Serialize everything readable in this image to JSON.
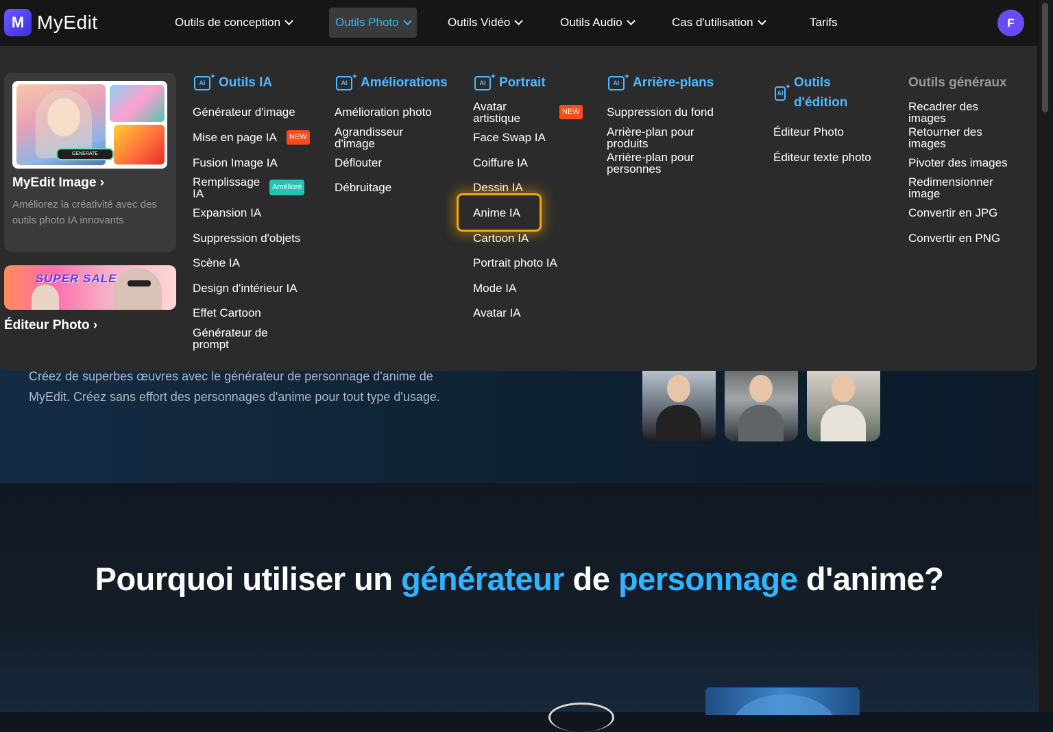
{
  "brand": {
    "logo_letter": "M",
    "name": "MyEdit"
  },
  "nav": {
    "items": [
      {
        "label": "Outils de conception"
      },
      {
        "label": "Outils Photo"
      },
      {
        "label": "Outils Vidéo"
      },
      {
        "label": "Outils Audio"
      },
      {
        "label": "Cas d'utilisation"
      },
      {
        "label": "Tarifs"
      }
    ],
    "active_index": 1,
    "avatar_letter": "F"
  },
  "promo": {
    "generate_label": "GENERATE",
    "title": "MyEdit Image ›",
    "description": "Améliorez la créativité avec des outils photo IA innovants",
    "sale_text": "SUPER SALE",
    "editor_link": "Éditeur Photo ›"
  },
  "columns": {
    "ai_tools": {
      "title": "Outils IA",
      "items": [
        "Générateur d'image",
        "Mise en page IA",
        "Fusion Image IA",
        "Remplissage IA",
        "Expansion IA",
        "Suppression d'objets",
        "Scène IA",
        "Design d'intérieur IA",
        "Effet Cartoon",
        "Générateur de prompt"
      ],
      "badge_new": "NEW",
      "badge_improved": "Amélioré"
    },
    "enhancements": {
      "title": "Améliorations",
      "items": [
        "Amélioration photo",
        "Agrandisseur d'image",
        "Déflouter",
        "Débruitage"
      ]
    },
    "portrait": {
      "title": "Portrait",
      "items": [
        "Avatar artistique",
        "Face Swap IA",
        "Coiffure IA",
        "Dessin IA",
        "Anime IA",
        "Cartoon IA",
        "Portrait photo IA",
        "Mode IA",
        "Avatar IA"
      ],
      "badge_new": "NEW",
      "highlighted": "Anime IA"
    },
    "backgrounds": {
      "title": "Arrière-plans",
      "items": [
        "Suppression du fond",
        "Arrière-plan pour produits",
        "Arrière-plan pour personnes"
      ]
    },
    "editing": {
      "title": "Outils d'édition",
      "items": [
        "Éditeur Photo",
        "Éditeur texte photo"
      ]
    },
    "general": {
      "title": "Outils généraux",
      "items": [
        "Recadrer des images",
        "Retourner des images",
        "Pivoter des images",
        "Redimensionner image",
        "Convertir en JPG",
        "Convertir en PNG"
      ]
    }
  },
  "page": {
    "hero_text": "Créez de superbes œuvres avec le générateur de personnage d'anime de MyEdit. Créez sans effort des personnages d'anime pour tout type d'usage.",
    "headline_parts": [
      "Pourquoi utiliser un ",
      "générateur",
      " de ",
      "personnage",
      " d'anime?"
    ]
  },
  "colors": {
    "accent_blue": "#2fb4ff",
    "highlight": "#f7a800",
    "badge_new": "#ff4a1c",
    "badge_improved": "#24c2b5",
    "avatar": "#6a4bf3"
  }
}
